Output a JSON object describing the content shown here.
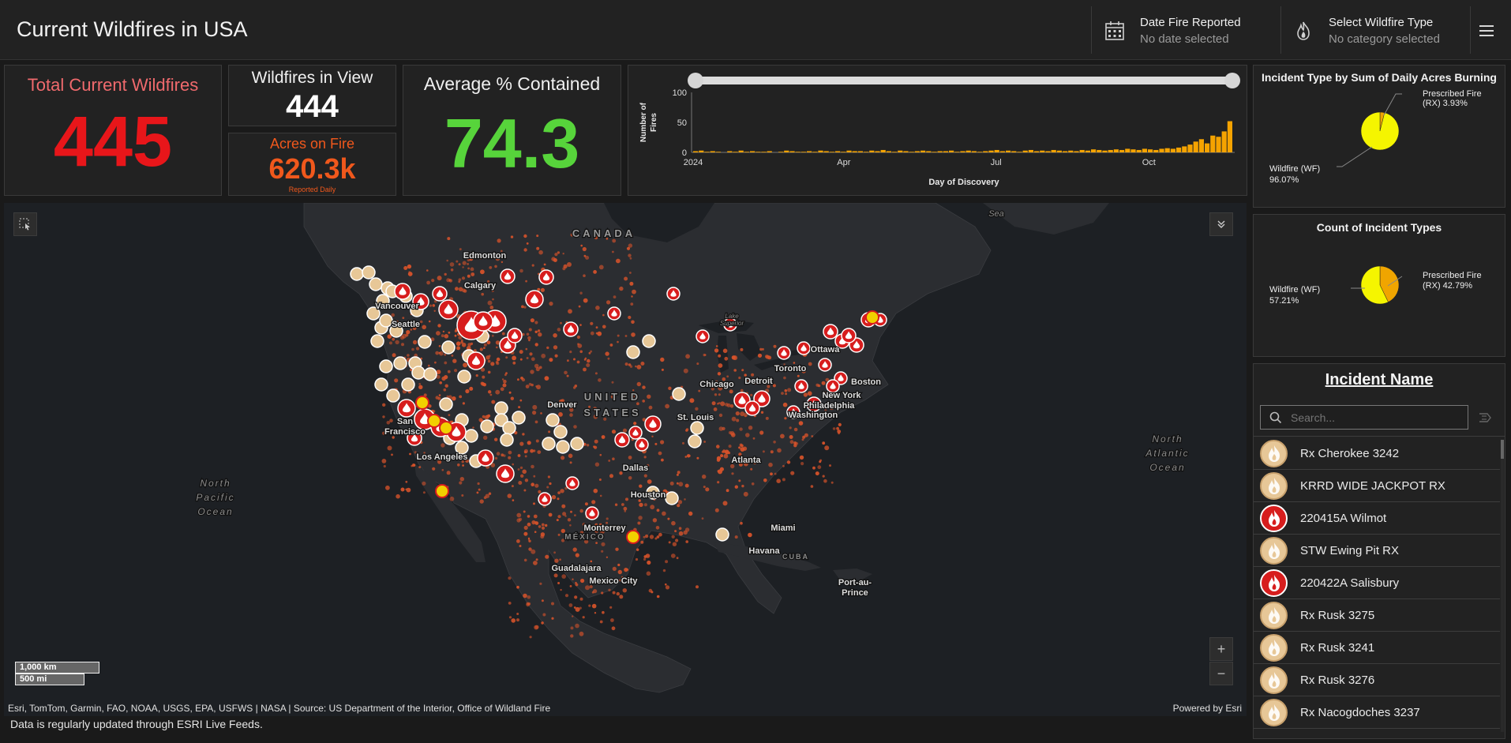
{
  "app": {
    "title": "Current Wildfires in USA",
    "filters": [
      {
        "label": "Date Fire Reported",
        "value": "No date selected",
        "icon": "calendar-icon"
      },
      {
        "label": "Select Wildfire Type",
        "value": "No category selected",
        "icon": "flame-icon"
      }
    ]
  },
  "kpis": {
    "total": {
      "title": "Total Current Wildfires",
      "value": "445",
      "color": "#e8161a",
      "title_color": "#f06a6d"
    },
    "in_view": {
      "title": "Wildfires in View",
      "value": "444"
    },
    "acres": {
      "title": "Acres on Fire",
      "value": "620.3k",
      "note": "Reported Daily",
      "color": "#f0581c"
    },
    "contained": {
      "title": "Average % Contained",
      "value": "74.3",
      "color": "#57d43b"
    }
  },
  "timeline": {
    "chart_data": {
      "type": "bar",
      "xlabel": "Day of Discovery",
      "ylabel": "Number of Fires",
      "ylim": [
        0,
        100
      ],
      "yticks": [
        "100",
        "50",
        "0"
      ],
      "xticks": [
        "2024",
        "Apr",
        "Jul",
        "Oct"
      ],
      "series_color": "#f5a300",
      "approx_daily_values": [
        2,
        3,
        1,
        2,
        1,
        0,
        2,
        1,
        3,
        1,
        2,
        1,
        1,
        2,
        0,
        1,
        3,
        2,
        1,
        1,
        2,
        1,
        3,
        2,
        1,
        2,
        1,
        3,
        2,
        2,
        1,
        3,
        2,
        4,
        2,
        1,
        3,
        2,
        1,
        2,
        3,
        2,
        1,
        2,
        2,
        3,
        1,
        2,
        3,
        2,
        1,
        2,
        3,
        4,
        2,
        3,
        2,
        1,
        3,
        4,
        2,
        3,
        2,
        4,
        3,
        2,
        3,
        2,
        4,
        3,
        5,
        4,
        3,
        4,
        5,
        4,
        6,
        5,
        4,
        6,
        5,
        4,
        6,
        7,
        6,
        8,
        10,
        13,
        18,
        22,
        15,
        28,
        26,
        35,
        52
      ]
    }
  },
  "pie1": {
    "title": "Incident Type by Sum of Daily Acres Burning",
    "chart_data": {
      "type": "pie",
      "slices": [
        {
          "name": "Wildfire (WF)",
          "value": 96.07,
          "label_line1": "Wildfire (WF)",
          "label_line2": "96.07%",
          "color": "#f5f500"
        },
        {
          "name": "Prescribed Fire (RX)",
          "value": 3.93,
          "label_line1": "Prescribed Fire",
          "label_line2": "(RX) 3.93%",
          "color": "#f0a500"
        }
      ]
    }
  },
  "pie2": {
    "title": "Count of Incident Types",
    "chart_data": {
      "type": "pie",
      "slices": [
        {
          "name": "Wildfire (WF)",
          "value": 57.21,
          "label_line1": "Wildfire (WF)",
          "label_line2": "57.21%",
          "color": "#f5f500"
        },
        {
          "name": "Prescribed Fire (RX)",
          "value": 42.79,
          "label_line1": "Prescribed Fire",
          "label_line2": "(RX) 42.79%",
          "color": "#f0a500"
        }
      ]
    }
  },
  "incidents": {
    "title": "Incident Name",
    "search_placeholder": "Search...",
    "items": [
      {
        "name": "Rx Cherokee 3242",
        "type": "rx"
      },
      {
        "name": "KRRD WIDE JACKPOT RX",
        "type": "rx"
      },
      {
        "name": "220415A Wilmot",
        "type": "wf"
      },
      {
        "name": "STW Ewing Pit RX",
        "type": "rx"
      },
      {
        "name": "220422A Salisbury",
        "type": "wf"
      },
      {
        "name": "Rx Rusk 3275",
        "type": "rx"
      },
      {
        "name": "Rx Rusk 3241",
        "type": "rx"
      },
      {
        "name": "Rx Rusk 3276",
        "type": "rx"
      },
      {
        "name": "Rx Nacogdoches 3237",
        "type": "rx"
      }
    ]
  },
  "map": {
    "labels": {
      "canada": "CANADA",
      "united_states_1": "UNITED",
      "united_states_2": "STATES",
      "mexico": "MÉXICO",
      "cuba": "CUBA",
      "north_pacific_1": "North",
      "north_pacific_2": "Pacific",
      "north_pacific_3": "Ocean",
      "north_atlantic_1": "North",
      "north_atlantic_2": "Atlantic",
      "north_atlantic_3": "Ocean",
      "sea": "Sea",
      "lake_superior_1": "Lake",
      "lake_superior_2": "Superior"
    },
    "cities": [
      "Edmonton",
      "Calgary",
      "Vancouver",
      "Seattle",
      "San Francisco",
      "Los Angeles",
      "Denver",
      "Dallas",
      "Houston",
      "Monterrey",
      "Guadalajara",
      "Mexico City",
      "Havana",
      "Port-au-Prince",
      "Miami",
      "Atlanta",
      "St. Louis",
      "Chicago",
      "Detroit",
      "Toronto",
      "Ottawa",
      "Boston",
      "New York",
      "Philadelphia",
      "Washington"
    ],
    "city_label_1": "San",
    "city_label_2": "Francisco",
    "city_label_3": "Port-au-",
    "city_label_4": "Prince",
    "scale_km": "1,000 km",
    "scale_mi": "500 mi",
    "zoom_in": "+",
    "zoom_out": "−",
    "attribution_left": "Esri, TomTom, Garmin, FAO, NOAA, USGS, EPA, USFWS | NASA | Source: US Department of the Interior, Office of Wildland Fire",
    "attribution_right": "Powered by Esri"
  },
  "footer": {
    "note": "Data is regularly updated through ESRI Live Feeds."
  },
  "colors": {
    "land": "#2b2d31",
    "water": "#1d2024",
    "rx_marker": "#e7c797",
    "wf_marker": "#d71d1d",
    "dot": "#d9532a"
  }
}
